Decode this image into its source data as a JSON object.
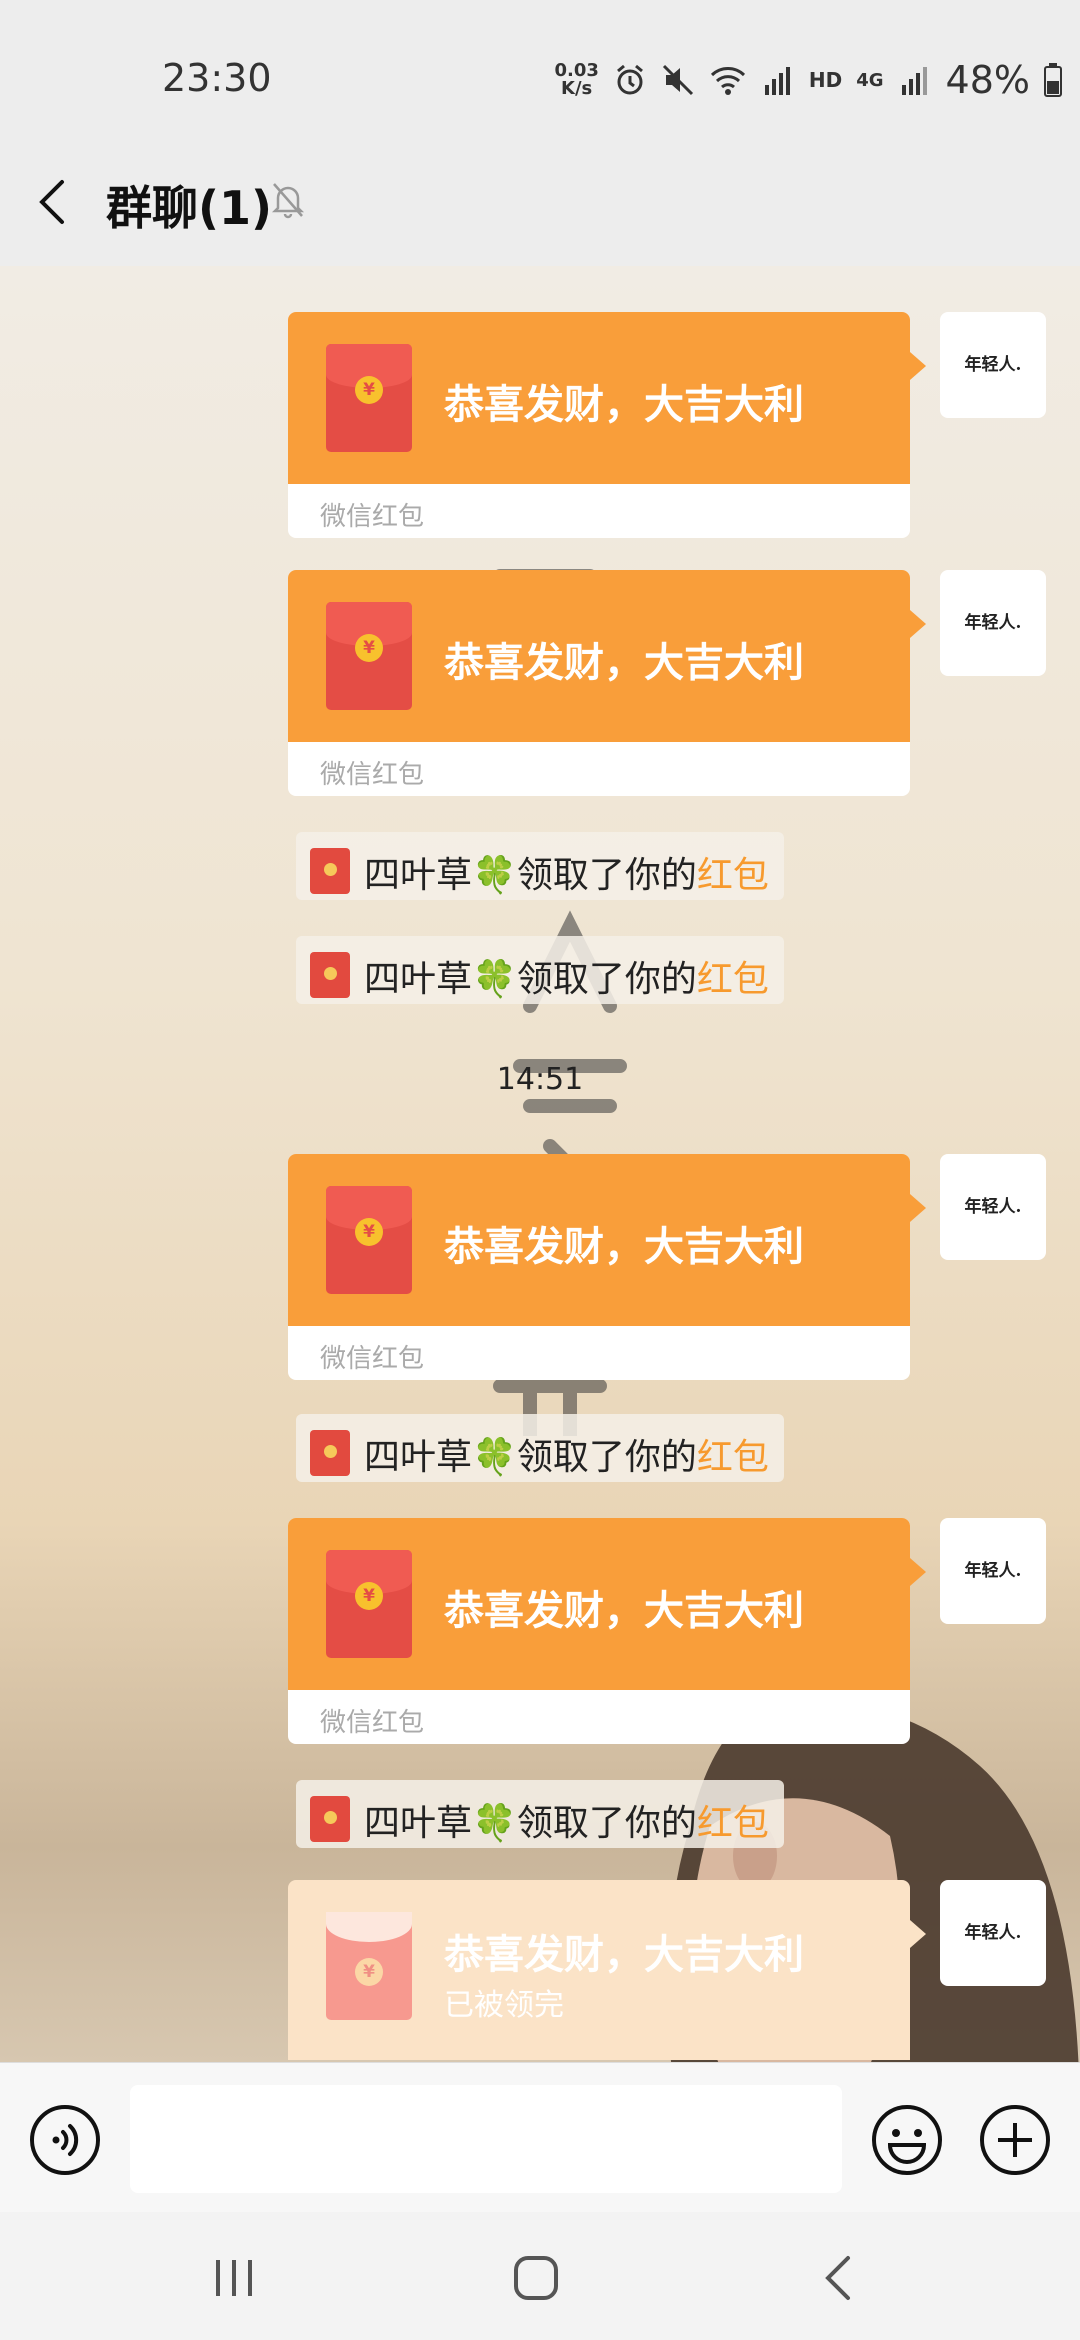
{
  "status_bar": {
    "time": "23:30",
    "net_speed_value": "0.03",
    "net_speed_unit": "K/s",
    "hd_label": "HD",
    "network_label": "4G",
    "battery": "48%"
  },
  "header": {
    "title": "群聊(1)"
  },
  "red_packet": {
    "greeting": "恭喜发财，大吉大利",
    "label": "微信红包",
    "coin_symbol": "¥"
  },
  "avatar": {
    "text": "年轻人."
  },
  "notice": {
    "prefix": "四叶草🍀领取了你的",
    "link": "红包"
  },
  "timestamp": "14:51",
  "opened_packet": {
    "greeting": "恭喜发财，大吉大利",
    "status": "已被领完"
  },
  "colors": {
    "packet_orange": "#f99e3a",
    "packet_red": "#e44d45",
    "highlight": "#f79a2e",
    "opened_packet": "#fbe3c7"
  }
}
